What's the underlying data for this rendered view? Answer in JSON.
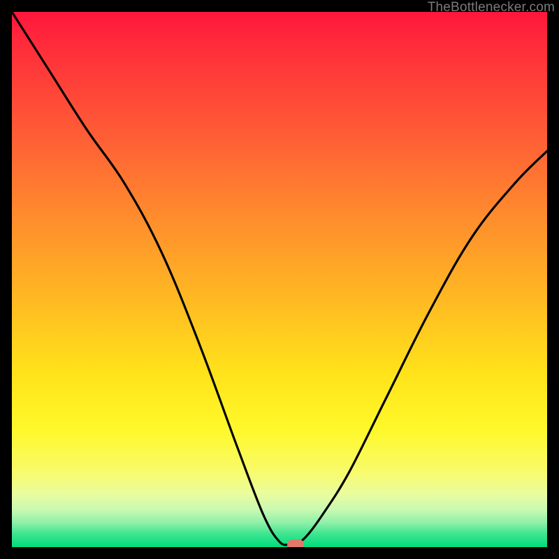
{
  "watermark": {
    "text": "TheBottlenecker.com"
  },
  "chart_data": {
    "type": "line",
    "title": "",
    "xlabel": "",
    "ylabel": "",
    "xlim": [
      0,
      100
    ],
    "ylim": [
      0,
      100
    ],
    "series": [
      {
        "name": "bottleneck-curve",
        "x": [
          0,
          7,
          14,
          21,
          28,
          35,
          42,
          47,
          50,
          52,
          53,
          55,
          58,
          63,
          70,
          78,
          86,
          94,
          100
        ],
        "values": [
          100,
          89,
          78,
          68,
          55,
          38,
          19,
          6,
          1,
          0.5,
          0.5,
          2,
          6,
          14,
          28,
          44,
          58,
          68,
          74
        ]
      }
    ],
    "flat_bottom": {
      "x_start": 49,
      "x_end": 53,
      "y": 0.5
    },
    "marker": {
      "x": 53,
      "y": 0.5,
      "color": "#e0786b"
    },
    "background_gradient": {
      "orientation": "vertical",
      "stops": [
        {
          "pos": 0,
          "color": "#ff163c"
        },
        {
          "pos": 0.22,
          "color": "#ff5a36"
        },
        {
          "pos": 0.54,
          "color": "#ffba22"
        },
        {
          "pos": 0.78,
          "color": "#fff82a"
        },
        {
          "pos": 0.93,
          "color": "#c9f9b2"
        },
        {
          "pos": 1.0,
          "color": "#00dd7d"
        }
      ]
    }
  }
}
